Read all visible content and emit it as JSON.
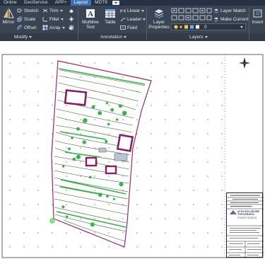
{
  "tabs": [
    "Online",
    "GeoService",
    "APP+",
    "Layout",
    "MDT9"
  ],
  "ribbon": {
    "modify": {
      "panel_label": "Modify",
      "mirror_label": "Mirror",
      "stretch_label": "Stretch",
      "scale_label": "Scale",
      "offset_label": "Offset",
      "trim_label": "Trim",
      "fillet_label": "Fillet",
      "array_label": "Array"
    },
    "annotation": {
      "panel_label": "Annotation",
      "multiline_text_label": "Multiline Text",
      "table_label": "Table",
      "linear_label": "Linear",
      "leader_label": "Leader",
      "field_label": "Field"
    },
    "layers": {
      "panel_label": "Layers",
      "layer_properties_label": "Layer Properties",
      "layer_match_label": "Layer Match",
      "make_current_label": "Make Current",
      "current_layer": "0"
    },
    "insert": {
      "insert_label": "Insert"
    }
  },
  "colors": {
    "tab_bg": "#263244",
    "tab_active": "#3d6fb4",
    "ribbon_bg": "#3b4453",
    "parcel_outline": "#9a2a6a",
    "building_fill": "#8a1e66",
    "vegetation": "#38b24a",
    "contour": "#2f5a2a"
  },
  "drawing": {
    "compass_icon": "north-arrow-icon",
    "company_name": "ALTA SOLUZIONE TOPOGRAFIA",
    "company_sub": "STUDIO TECNICO"
  }
}
